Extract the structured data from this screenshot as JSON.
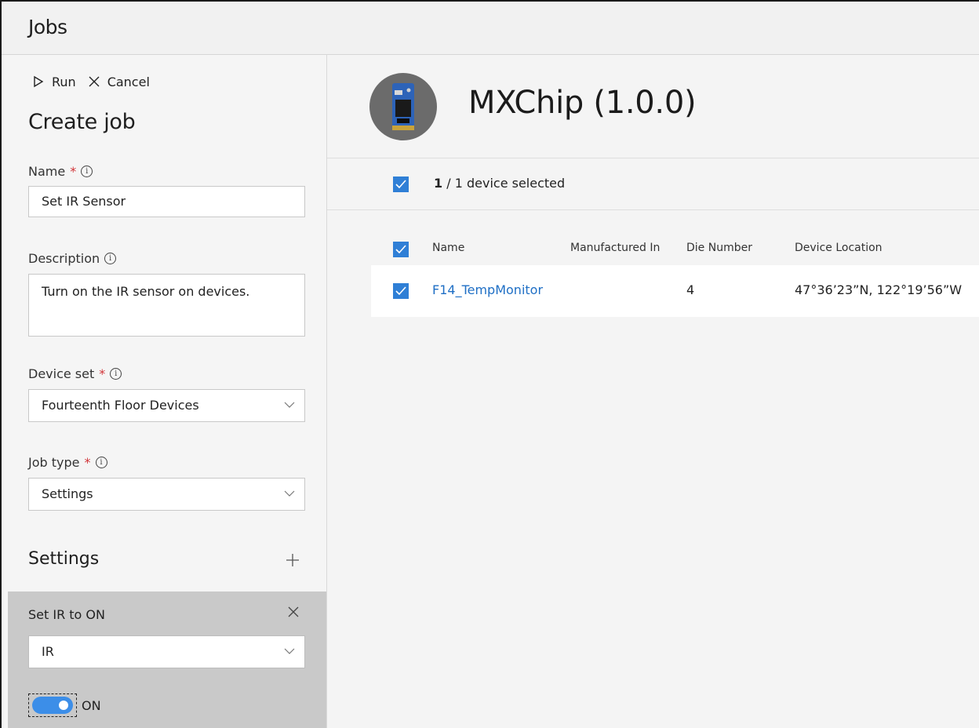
{
  "app": {
    "title": "Jobs"
  },
  "toolbar": {
    "run_label": "Run",
    "cancel_label": "Cancel"
  },
  "form": {
    "title": "Create job",
    "name_label": "Name",
    "name_value": "Set IR Sensor",
    "description_label": "Description",
    "description_value": "Turn on the IR sensor on devices.",
    "device_set_label": "Device set",
    "device_set_value": "Fourteenth Floor Devices",
    "job_type_label": "Job type",
    "job_type_value": "Settings",
    "required_mark": "*",
    "info_glyph": "i"
  },
  "settings": {
    "heading": "Settings",
    "card_title": "Set IR to ON",
    "property_value": "IR",
    "toggle_label": "ON",
    "toggle_state": true
  },
  "device": {
    "title": "MXChip (1.0.0)",
    "selected_count": "1",
    "selection_suffix": "/ 1 device selected"
  },
  "table": {
    "columns": [
      "Name",
      "Manufactured In",
      "Die Number",
      "Device Location"
    ],
    "rows": [
      {
        "name": "F14_TempMonitor",
        "manufactured_in": "",
        "die_number": "4",
        "location": "47°36’23”N, 122°19’56”W"
      }
    ]
  },
  "colors": {
    "accent": "#2f7fd6",
    "link": "#1f6fc5",
    "required": "#d13438",
    "toggle": "#3c8ee8"
  },
  "icons": [
    "play-icon",
    "close-icon",
    "info-icon",
    "chevron-down-icon",
    "plus-icon",
    "checkmark-icon",
    "device-board-icon"
  ]
}
